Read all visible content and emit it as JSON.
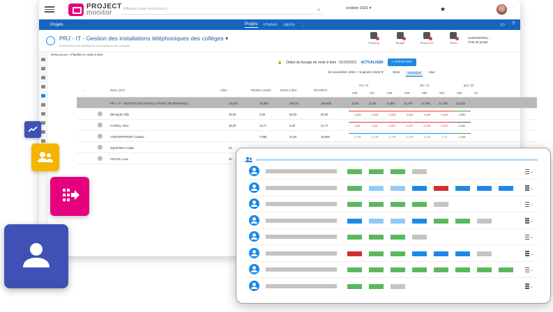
{
  "topbar": {
    "brand_line1": "PROJECT",
    "brand_line2": "monitor",
    "search_placeholder": "Effectuez votre recherche ici...",
    "period": "octobre 2021 ▾"
  },
  "nav": {
    "section": "Projets",
    "tabs": [
      "Projets",
      "Phases",
      "Jalons"
    ],
    "active_tab": "Projets"
  },
  "project": {
    "title": "PRJ - IT - Gestion des installations téléphoniques des collèges ▾",
    "subtitle": "Amélioration des installations téléphoniques des collèges",
    "actions": [
      "Planning",
      "Budget",
      "Ressource",
      "Statut"
    ],
    "chef_line1": "CHEFDEPRO...",
    "chef_line2": "Chef de projet"
  },
  "breadcrumb": "Ressources > Planifier le reste à faire",
  "toolbar": {
    "lissage": "Début du lissage du reste à faire : 01/10/2021",
    "refresh": "ACTUALISER",
    "add": "+ AFFECTER",
    "range": "15 novembre 2021 > 9 janvier 2022 ▾",
    "views": [
      "Mois",
      "Semaine",
      "Jour"
    ],
    "active_view": "Semaine"
  },
  "grid": {
    "headers": [
      "Ress. (J/H)",
      "Cible",
      "Réalisé cumulé",
      "Reste à faire",
      "Ré-estimé"
    ],
    "months": [
      "nov. 21",
      "déc. 21",
      "janv. 22"
    ],
    "weeks": [
      "S46",
      "S47",
      "S48",
      "S49",
      "S50",
      "S51",
      "S52",
      "S1"
    ],
    "project_row": {
      "name": "PRJ - IT - GESTION DES INSTALLATIONS TÉLÉPHONIQU...",
      "sub": "Du 01/09/2021 au 31/12/2021",
      "cible": "154,00",
      "realise": "36,605",
      "reste": "160,00",
      "reestime": "196,605",
      "weeks": [
        "12,82",
        "12,82",
        "12,807",
        "12,797",
        "12,785",
        "12,786",
        "10,225",
        "-"
      ]
    },
    "rows": [
      {
        "name": "BRAQUE Gille",
        "cible": "45,00",
        "realise": "4,00",
        "reste": "56,00",
        "reestime": "60,00",
        "weeks": [
          "4,445",
          "4,445",
          "4,445",
          "4,445",
          "4,445",
          "4,445",
          "3,552"
        ],
        "colors": [
          "red",
          "red",
          "red",
          "red",
          "red",
          "red",
          "green"
        ]
      },
      {
        "name": "CAROLL Alice",
        "cible": "45,00",
        "realise": "10,77",
        "reste": "2,00",
        "reestime": "21,77",
        "weeks": [
          "0,25",
          "0,25",
          "0,237",
          "0,227",
          "0,225",
          "0,227",
          "0,181"
        ],
        "colors": [
          "red",
          "red",
          "red",
          "red",
          "red",
          "red",
          "dark"
        ]
      },
      {
        "name": "CHEFDEPROJET Ludovic",
        "cible": "-",
        "realise": "7,655",
        "reste": "22,00",
        "reestime": "29,655",
        "weeks": [
          "1,775",
          "1,775",
          "1,775",
          "1,775",
          "1,774",
          "1,77",
          "1,416"
        ],
        "colors": [
          "blue",
          "blue",
          "blue",
          "blue",
          "blue",
          "blue",
          "green"
        ]
      },
      {
        "name": "EQUIPIER Coralie",
        "cible": "24",
        "realise": "",
        "reste": "",
        "reestime": "",
        "weeks": [],
        "colors": []
      },
      {
        "name": "PILOTE Lucie",
        "cible": "40",
        "realise": "",
        "reste": "",
        "reestime": "",
        "weeks": [],
        "colors": []
      }
    ]
  },
  "overlay": {
    "rows": [
      [
        "#5cb85c",
        "#5cb85c",
        "#5cb85c",
        "#c4c4c4"
      ],
      [
        "#5cb85c",
        "#90caf9",
        "#90caf9",
        "#1e88e5",
        "#d32f2f",
        "#1e88e5",
        "#1e88e5",
        "#1e88e5"
      ],
      [
        "#5cb85c",
        "#5cb85c",
        "#5cb85c",
        "#5cb85c",
        "#c4c4c4"
      ],
      [
        "#1e88e5",
        "#90caf9",
        "#90caf9",
        "#1e88e5",
        "#5cb85c",
        "#5cb85c",
        "#c4c4c4"
      ],
      [
        "#5cb85c",
        "#5cb85c",
        "#5cb85c",
        "#c4c4c4"
      ],
      [
        "#d32f2f",
        "#5cb85c",
        "#5cb85c",
        "#1e88e5",
        "#1e88e5",
        "#1e88e5",
        "#c4c4c4"
      ],
      [
        "#5cb85c",
        "#5cb85c",
        "#5cb85c",
        "#5cb85c",
        "#5cb85c",
        "#5cb85c",
        "#5cb85c",
        "#5cb85c"
      ],
      [
        "#5cb85c",
        "#5cb85c",
        "#c4c4c4"
      ]
    ]
  }
}
